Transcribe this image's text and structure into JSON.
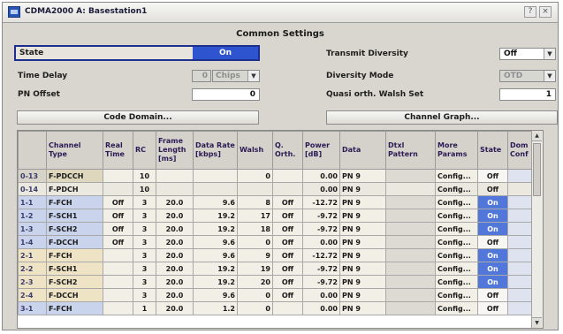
{
  "window": {
    "title": "CDMA2000 A: Basestation1",
    "close_glyph": "×",
    "help_glyph": "?"
  },
  "common_settings": {
    "section_title": "Common Settings",
    "state": {
      "label": "State",
      "value": "On"
    },
    "time_delay": {
      "label": "Time Delay",
      "value": "0",
      "unit": "Chips"
    },
    "pn_offset": {
      "label": "PN Offset",
      "value": "0"
    },
    "transmit_diversity": {
      "label": "Transmit Diversity",
      "value": "Off"
    },
    "diversity_mode": {
      "label": "Diversity Mode",
      "value": "OTD"
    },
    "quasi_walsh": {
      "label": "Quasi orth. Walsh Set",
      "value": "1"
    },
    "code_domain_button": "Code Domain...",
    "channel_graph_button": "Channel Graph..."
  },
  "table": {
    "headers": [
      "",
      "Channel Type",
      "Real Time",
      "RC",
      "Frame Length [ms]",
      "Data Rate [kbps]",
      "Walsh",
      "Q. Orth.",
      "Power [dB]",
      "Data",
      "Dtxl Pattern",
      "More Params",
      "State",
      "Dom Conf"
    ],
    "rows": [
      {
        "id": "0-13",
        "type": "F-PDCCH",
        "real_time": "",
        "rc": "10",
        "frame_length": "",
        "data_rate": "",
        "walsh": "0",
        "q_orth": "",
        "power": "0.00",
        "data": "PN 9",
        "dtx": "",
        "more": "Config...",
        "state": "Off",
        "group": "pdcch"
      },
      {
        "id": "0-14",
        "type": "F-PDCH",
        "real_time": "",
        "rc": "10",
        "frame_length": "",
        "data_rate": "",
        "walsh": "",
        "q_orth": "",
        "power": "0.00",
        "data": "PN 9",
        "dtx": "",
        "more": "Config...",
        "state": "Off",
        "group": "pilot"
      },
      {
        "id": "1-1",
        "type": "F-FCH",
        "real_time": "Off",
        "rc": "3",
        "frame_length": "20.0",
        "data_rate": "9.6",
        "walsh": "8",
        "q_orth": "Off",
        "power": "-12.72",
        "data": "PN 9",
        "dtx": "",
        "more": "Config...",
        "state": "On",
        "group": "blue"
      },
      {
        "id": "1-2",
        "type": "F-SCH1",
        "real_time": "Off",
        "rc": "3",
        "frame_length": "20.0",
        "data_rate": "19.2",
        "walsh": "17",
        "q_orth": "Off",
        "power": "-9.72",
        "data": "PN 9",
        "dtx": "",
        "more": "Config...",
        "state": "On",
        "group": "blue"
      },
      {
        "id": "1-3",
        "type": "F-SCH2",
        "real_time": "Off",
        "rc": "3",
        "frame_length": "20.0",
        "data_rate": "19.2",
        "walsh": "18",
        "q_orth": "Off",
        "power": "-9.72",
        "data": "PN 9",
        "dtx": "",
        "more": "Config...",
        "state": "On",
        "group": "blue"
      },
      {
        "id": "1-4",
        "type": "F-DCCH",
        "real_time": "Off",
        "rc": "3",
        "frame_length": "20.0",
        "data_rate": "9.6",
        "walsh": "0",
        "q_orth": "Off",
        "power": "0.00",
        "data": "PN 9",
        "dtx": "",
        "more": "Config...",
        "state": "Off",
        "group": "blue"
      },
      {
        "id": "2-1",
        "type": "F-FCH",
        "real_time": "",
        "rc": "3",
        "frame_length": "20.0",
        "data_rate": "9.6",
        "walsh": "9",
        "q_orth": "Off",
        "power": "-12.72",
        "data": "PN 9",
        "dtx": "",
        "more": "Config...",
        "state": "On",
        "group": "beige"
      },
      {
        "id": "2-2",
        "type": "F-SCH1",
        "real_time": "",
        "rc": "3",
        "frame_length": "20.0",
        "data_rate": "19.2",
        "walsh": "19",
        "q_orth": "Off",
        "power": "-9.72",
        "data": "PN 9",
        "dtx": "",
        "more": "Config...",
        "state": "On",
        "group": "beige"
      },
      {
        "id": "2-3",
        "type": "F-SCH2",
        "real_time": "",
        "rc": "3",
        "frame_length": "20.0",
        "data_rate": "19.2",
        "walsh": "20",
        "q_orth": "Off",
        "power": "-9.72",
        "data": "PN 9",
        "dtx": "",
        "more": "Config...",
        "state": "On",
        "group": "beige"
      },
      {
        "id": "2-4",
        "type": "F-DCCH",
        "real_time": "",
        "rc": "3",
        "frame_length": "20.0",
        "data_rate": "9.6",
        "walsh": "0",
        "q_orth": "Off",
        "power": "0.00",
        "data": "PN 9",
        "dtx": "",
        "more": "Config...",
        "state": "Off",
        "group": "beige"
      },
      {
        "id": "3-1",
        "type": "F-FCH",
        "real_time": "",
        "rc": "1",
        "frame_length": "20.0",
        "data_rate": "1.2",
        "walsh": "0",
        "q_orth": "",
        "power": "0.00",
        "data": "PN 9",
        "dtx": "",
        "more": "Config...",
        "state": "Off",
        "group": "blue"
      }
    ]
  },
  "colors": {
    "accent_on": "#2f54cf",
    "state_on_cell": "#5277db",
    "focus_border": "#1c2f8c"
  }
}
